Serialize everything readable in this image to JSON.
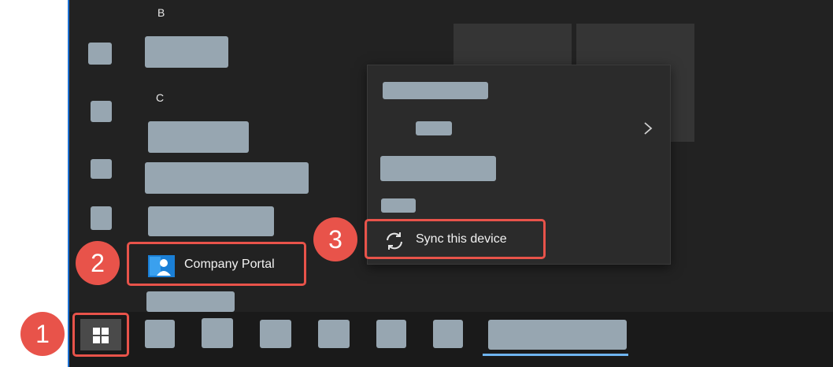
{
  "start_menu": {
    "section_b": "B",
    "section_c": "C",
    "company_portal": {
      "label": "Company Portal",
      "icon": "company-portal-icon"
    }
  },
  "context_menu": {
    "sync_item": {
      "label": "Sync this device",
      "icon": "sync-icon"
    },
    "submenu_arrow": "chevron-right-icon"
  },
  "taskbar": {
    "start_button": {
      "icon": "windows-logo-icon"
    }
  },
  "callouts": [
    "1",
    "2",
    "3"
  ],
  "colors": {
    "callout": "#e8534a",
    "background": "#222222",
    "redacted": "#97a6b1",
    "accent": "#1c6fd1"
  }
}
